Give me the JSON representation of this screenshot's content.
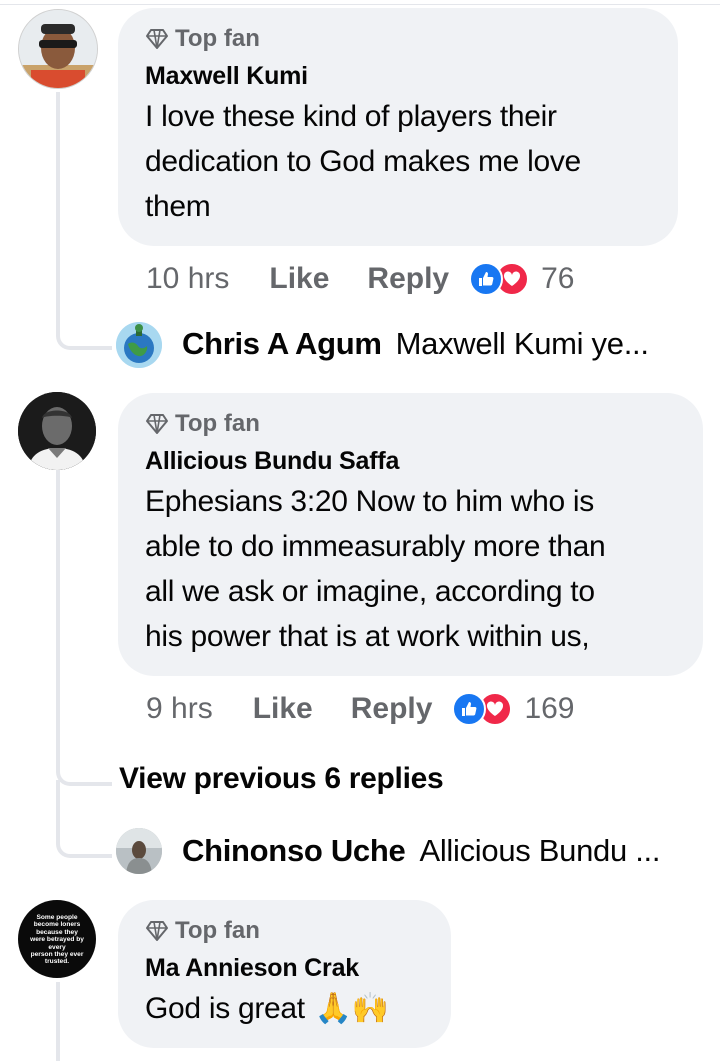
{
  "colors": {
    "bubble": "#f0f2f5",
    "secondary_text": "#65676b",
    "like_blue": "#1877f2",
    "love_red": "#f02849",
    "thread_line": "#e4e6eb"
  },
  "comments": [
    {
      "badge": "Top fan",
      "badge_icon": "diamond-icon",
      "author": "Maxwell Kumi",
      "lines": [
        "I love these kind of players their",
        "dedication to  God makes me love",
        "them"
      ],
      "time": "10 hrs",
      "like_label": "Like",
      "reply_label": "Reply",
      "reaction_count": "76",
      "reply": {
        "name": "Chris A Agum",
        "text": "Maxwell Kumi ye..."
      }
    },
    {
      "badge": "Top fan",
      "badge_icon": "diamond-icon",
      "author": "Allicious Bundu Saffa",
      "lines": [
        "Ephesians 3:20 Now to him who is",
        "able to do immeasurably more than",
        "all we ask or imagine, according to",
        "his power that is at work within us,"
      ],
      "time": "9 hrs",
      "like_label": "Like",
      "reply_label": "Reply",
      "reaction_count": "169",
      "view_previous": "View previous 6 replies",
      "reply": {
        "name": "Chinonso Uche",
        "text": "Allicious Bundu ..."
      }
    },
    {
      "badge": "Top fan",
      "badge_icon": "diamond-icon",
      "author": "Ma Annieson Crak",
      "text": "God is great",
      "emoji": "🙏🙌",
      "avatar_text": [
        "Some people",
        "become loners",
        "because they",
        "were betrayed by",
        "every",
        "person they ever",
        "trusted."
      ]
    }
  ]
}
